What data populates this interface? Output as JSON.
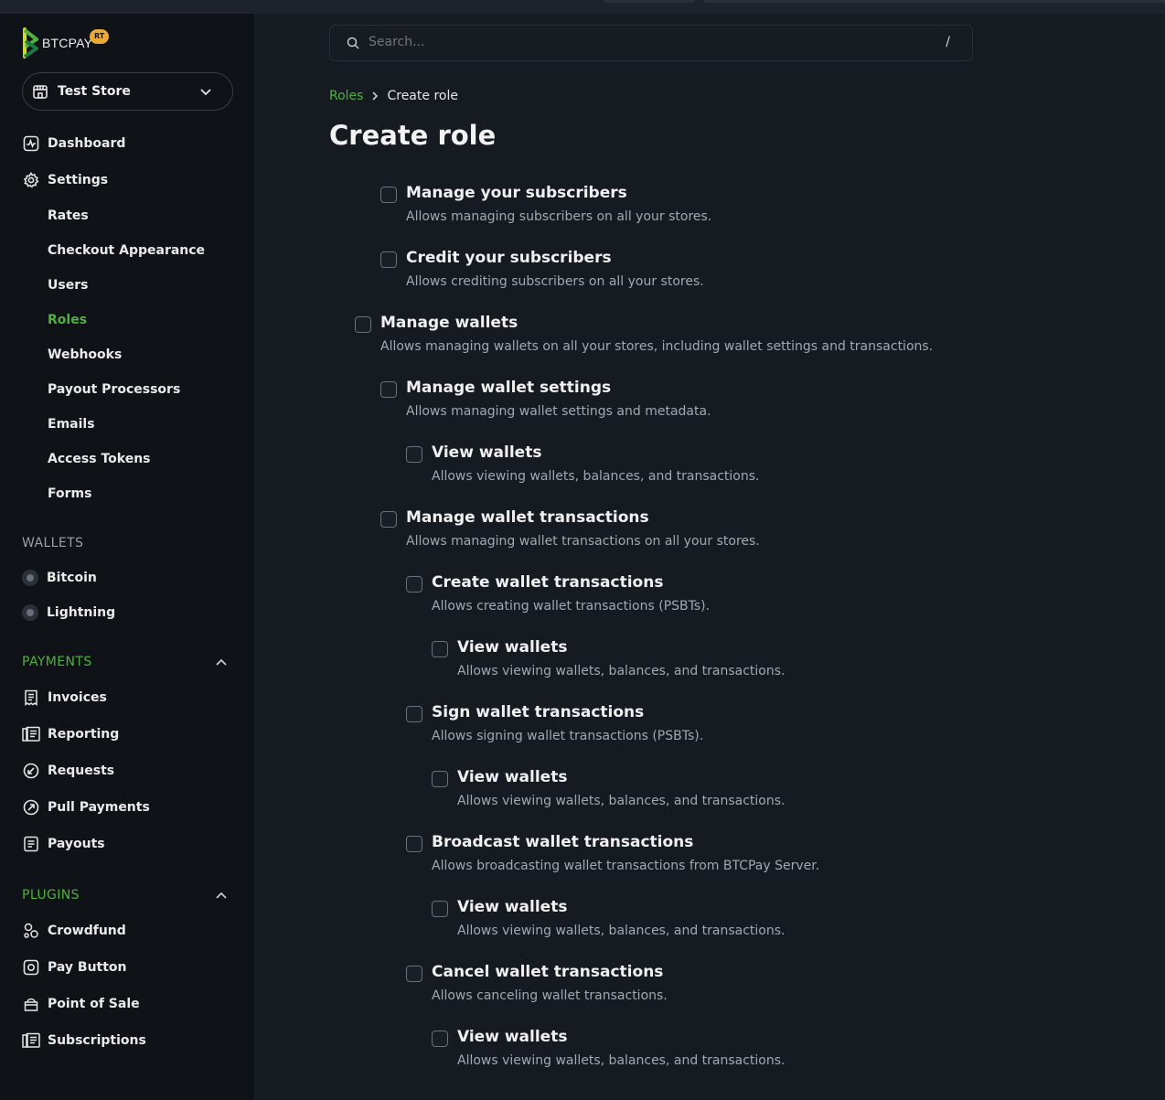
{
  "brand": {
    "name": "BTCPAY",
    "badge": "RT"
  },
  "store": {
    "name": "Test Store"
  },
  "nav": {
    "dashboard": "Dashboard",
    "settings": "Settings",
    "settings_items": [
      "Rates",
      "Checkout Appearance",
      "Users",
      "Roles",
      "Webhooks",
      "Payout Processors",
      "Emails",
      "Access Tokens",
      "Forms"
    ],
    "active_settings_item": "Roles",
    "wallets_heading": "WALLETS",
    "wallets": [
      "Bitcoin",
      "Lightning"
    ],
    "payments_heading": "PAYMENTS",
    "payments": [
      "Invoices",
      "Reporting",
      "Requests",
      "Pull Payments",
      "Payouts"
    ],
    "plugins_heading": "PLUGINS",
    "plugins": [
      "Crowdfund",
      "Pay Button",
      "Point of Sale",
      "Subscriptions"
    ]
  },
  "search": {
    "placeholder": "Search...",
    "shortcut": "/"
  },
  "breadcrumb": {
    "parent": "Roles",
    "current": "Create role"
  },
  "page_title": "Create role",
  "permissions": [
    {
      "title": "Manage your subscribers",
      "desc": "Allows managing subscribers on all your stores.",
      "level": 1,
      "checked": false
    },
    {
      "title": "Credit your subscribers",
      "desc": "Allows crediting subscribers on all your stores.",
      "level": 1,
      "checked": false
    },
    {
      "title": "Manage wallets",
      "desc": "Allows managing wallets on all your stores, including wallet settings and transactions.",
      "level": 0,
      "checked": false
    },
    {
      "title": "Manage wallet settings",
      "desc": "Allows managing wallet settings and metadata.",
      "level": 1,
      "checked": false
    },
    {
      "title": "View wallets",
      "desc": "Allows viewing wallets, balances, and transactions.",
      "level": 2,
      "checked": false
    },
    {
      "title": "Manage wallet transactions",
      "desc": "Allows managing wallet transactions on all your stores.",
      "level": 1,
      "checked": false
    },
    {
      "title": "Create wallet transactions",
      "desc": "Allows creating wallet transactions (PSBTs).",
      "level": 2,
      "checked": false
    },
    {
      "title": "View wallets",
      "desc": "Allows viewing wallets, balances, and transactions.",
      "level": 3,
      "checked": false
    },
    {
      "title": "Sign wallet transactions",
      "desc": "Allows signing wallet transactions (PSBTs).",
      "level": 2,
      "checked": false
    },
    {
      "title": "View wallets",
      "desc": "Allows viewing wallets, balances, and transactions.",
      "level": 3,
      "checked": false
    },
    {
      "title": "Broadcast wallet transactions",
      "desc": "Allows broadcasting wallet transactions from BTCPay Server.",
      "level": 2,
      "checked": false
    },
    {
      "title": "View wallets",
      "desc": "Allows viewing wallets, balances, and transactions.",
      "level": 3,
      "checked": false
    },
    {
      "title": "Cancel wallet transactions",
      "desc": "Allows canceling wallet transactions.",
      "level": 2,
      "checked": false
    },
    {
      "title": "View wallets",
      "desc": "Allows viewing wallets, balances, and transactions.",
      "level": 3,
      "checked": false
    }
  ],
  "colors": {
    "accent": "#51b13e",
    "badge": "#e9a93b",
    "background": "#161b22",
    "sidebar": "#0f1216"
  }
}
